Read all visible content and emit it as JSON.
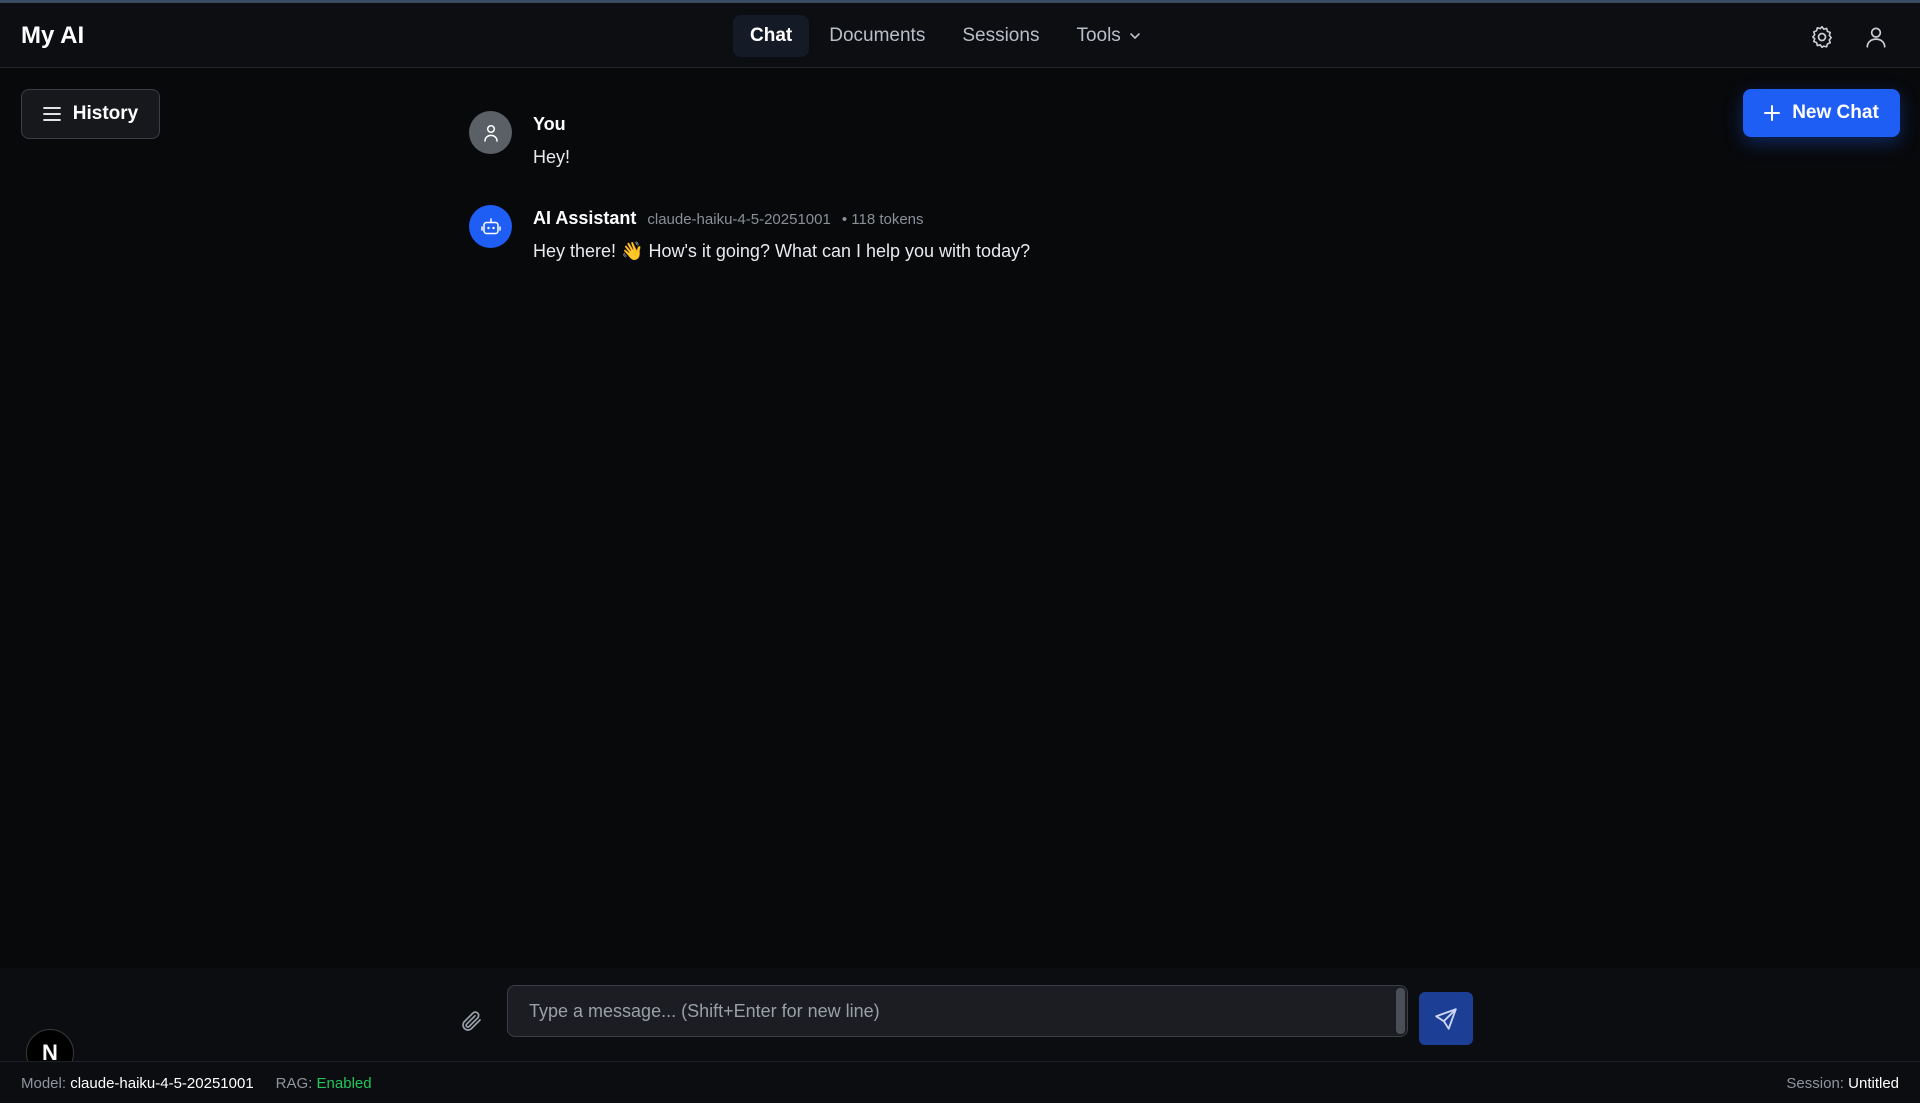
{
  "app": {
    "title": "My AI"
  },
  "nav": {
    "items": [
      {
        "label": "Chat",
        "active": true
      },
      {
        "label": "Documents",
        "active": false
      },
      {
        "label": "Sessions",
        "active": false
      },
      {
        "label": "Tools",
        "active": false,
        "has_dropdown": true
      }
    ]
  },
  "header_icons": [
    "gear-icon",
    "user-icon"
  ],
  "history_button": {
    "label": "History",
    "icon": "menu-icon"
  },
  "new_chat_button": {
    "label": "New Chat",
    "icon": "plus-icon"
  },
  "messages": [
    {
      "author": "You",
      "role": "user",
      "text": "Hey!",
      "icon": "user-icon"
    },
    {
      "author": "AI Assistant",
      "role": "assistant",
      "model": "claude-haiku-4-5-20251001",
      "tokens": "• 118 tokens",
      "text": "Hey there! 👋 How's it going? What can I help you with today?",
      "icon": "bot-icon"
    }
  ],
  "composer": {
    "placeholder": "Type a message... (Shift+Enter for new line)",
    "value": "",
    "attach_icon": "paperclip-icon",
    "send_icon": "send-icon"
  },
  "badge": {
    "letter": "N"
  },
  "status_bar": {
    "model_label": "Model:",
    "model_value": "claude-haiku-4-5-20251001",
    "rag_label": "RAG:",
    "rag_value": "Enabled",
    "session_label": "Session:",
    "session_value": "Untitled"
  },
  "colors": {
    "accent": "#1e5ef5",
    "background": "#08090b",
    "rag_enabled": "#22c55e"
  }
}
